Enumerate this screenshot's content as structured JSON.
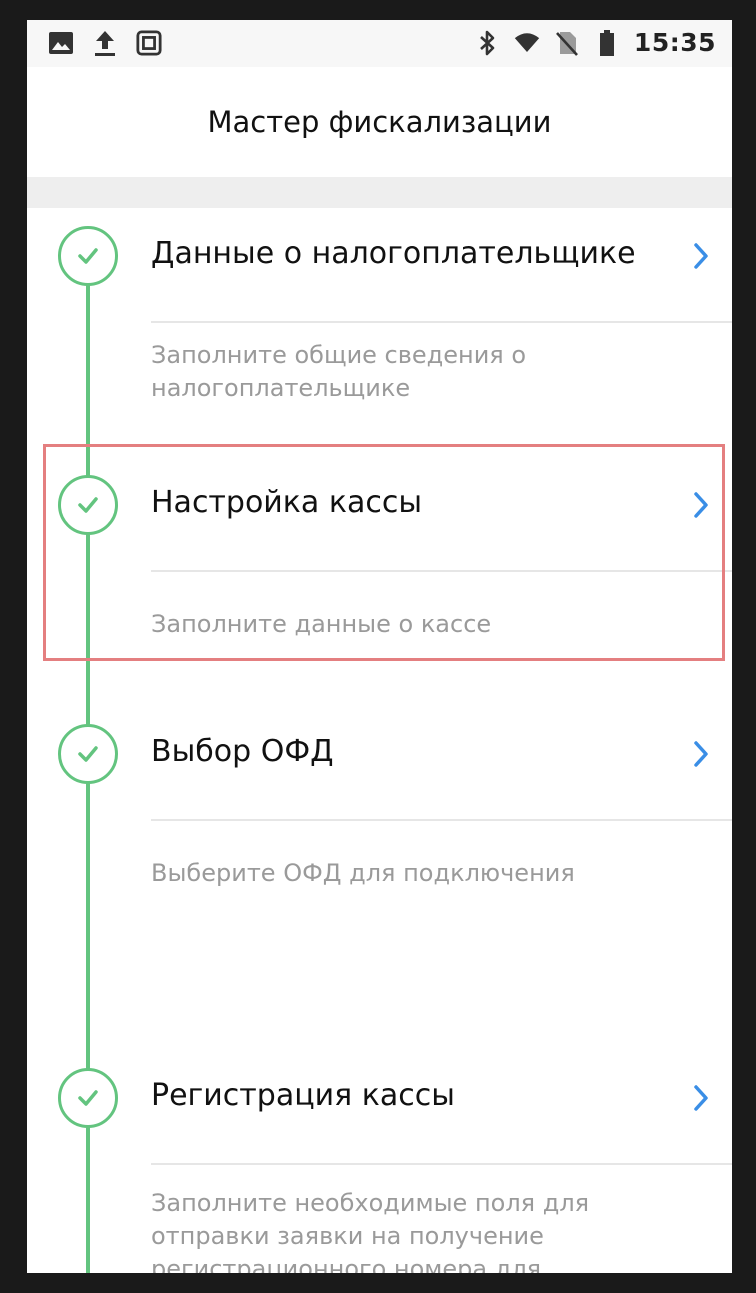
{
  "status_bar": {
    "time": "15:35",
    "left_icons": [
      "image-icon",
      "upload-icon",
      "screen-frame-icon"
    ],
    "right_icons": [
      "bluetooth-icon",
      "wifi-icon",
      "no-sim-icon",
      "battery-icon"
    ]
  },
  "header": {
    "title": "Мастер фискализации"
  },
  "colors": {
    "accent_green": "#63c47f",
    "chevron_blue": "#3a8ee6",
    "highlight_red": "#e47f80"
  },
  "steps": [
    {
      "title": "Данные о налогоплательщике",
      "description": "Заполните общие сведения о налогоплательщике",
      "status_icon": "check-icon",
      "action_icon": "chevron-right-icon"
    },
    {
      "title": "Настройка кассы",
      "description": "Заполните данные о кассе",
      "status_icon": "check-icon",
      "action_icon": "chevron-right-icon"
    },
    {
      "title": "Выбор ОФД",
      "description": "Выберите ОФД для подключения",
      "status_icon": "check-icon",
      "action_icon": "chevron-right-icon"
    },
    {
      "title": "Регистрация кассы",
      "description": "Заполните необходимые поля для отправки заявки на получение регистрационного номера для",
      "status_icon": "check-icon",
      "action_icon": "chevron-right-icon"
    }
  ]
}
